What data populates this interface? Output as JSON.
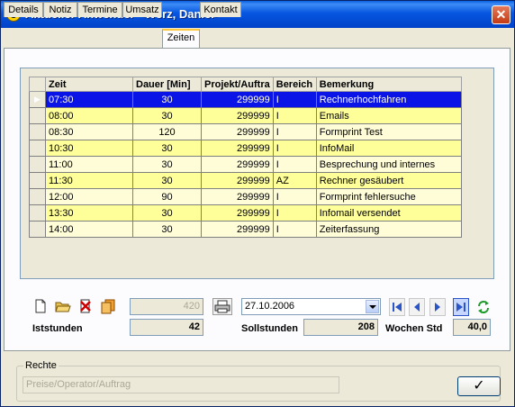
{
  "window": {
    "title": "Aktueller Anwender <Werz, Daniel>",
    "close_glyph": "✕"
  },
  "tabs": [
    {
      "label": "Details"
    },
    {
      "label": "Notiz"
    },
    {
      "label": "Termine"
    },
    {
      "label": "Umsatz"
    },
    {
      "label": "Zeiten",
      "active": true
    },
    {
      "label": "Kontakt"
    }
  ],
  "grid": {
    "columns": [
      "Zeit",
      "Dauer [Min]",
      "Projekt/Auftra",
      "Bereich",
      "Bemerkung"
    ],
    "rows": [
      {
        "zeit": "07:30",
        "dauer": "30",
        "projekt": "299999",
        "bereich": "I",
        "bemerkung": "Rechnerhochfahren"
      },
      {
        "zeit": "08:00",
        "dauer": "30",
        "projekt": "299999",
        "bereich": "I",
        "bemerkung": "Emails"
      },
      {
        "zeit": "08:30",
        "dauer": "120",
        "projekt": "299999",
        "bereich": "I",
        "bemerkung": "Formprint Test"
      },
      {
        "zeit": "10:30",
        "dauer": "30",
        "projekt": "299999",
        "bereich": "I",
        "bemerkung": "InfoMail"
      },
      {
        "zeit": "11:00",
        "dauer": "30",
        "projekt": "299999",
        "bereich": "I",
        "bemerkung": "Besprechung und internes"
      },
      {
        "zeit": "11:30",
        "dauer": "30",
        "projekt": "299999",
        "bereich": "AZ",
        "bemerkung": "Rechner gesäubert"
      },
      {
        "zeit": "12:00",
        "dauer": "90",
        "projekt": "299999",
        "bereich": "I",
        "bemerkung": "Formprint fehlersuche"
      },
      {
        "zeit": "13:30",
        "dauer": "30",
        "projekt": "299999",
        "bereich": "I",
        "bemerkung": "Infomail versendet"
      },
      {
        "zeit": "14:00",
        "dauer": "30",
        "projekt": "299999",
        "bereich": "I",
        "bemerkung": "Zeiterfassung"
      }
    ],
    "selected_row_color": "#0a14e6",
    "row_colors": [
      "#fffdd8",
      "#ffff99"
    ]
  },
  "toolbar": {
    "total_field": "420",
    "date": "27.10.2006"
  },
  "stats": {
    "iststunden_label": "Iststunden",
    "iststunden_value": "42",
    "sollstunden_label": "Sollstunden",
    "sollstunden_value": "208",
    "wochen_label": "Wochen Std",
    "wochen_value": "40,0"
  },
  "rechte": {
    "group_label": "Rechte",
    "value": "Preise/Operator/Auftrag",
    "ok_glyph": "✓"
  }
}
